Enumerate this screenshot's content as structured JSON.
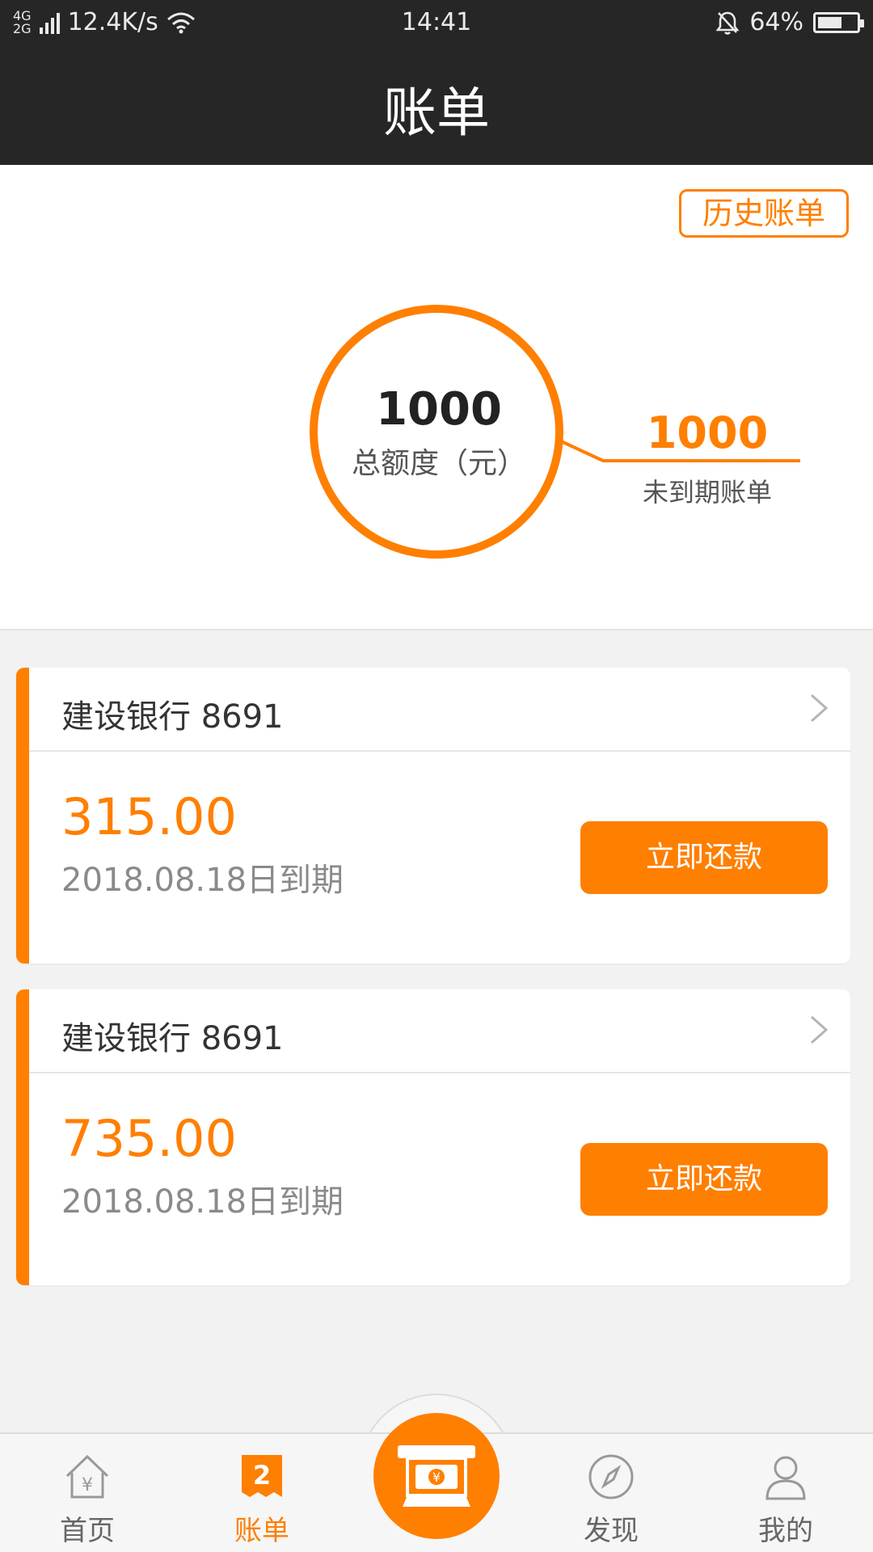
{
  "status_bar": {
    "network": "4G 2G",
    "speed": "12.4K/s",
    "time": "14:41",
    "battery": "64%",
    "battery_level": 0.64
  },
  "header": {
    "title": "账单"
  },
  "summary": {
    "history_button": "历史账单",
    "total_amount": "1000",
    "total_label": "总额度（元）",
    "unexpired_amount": "1000",
    "unexpired_label": "未到期账单"
  },
  "bills": [
    {
      "bank": "建设银行 8691",
      "amount": "315.00",
      "due": "2018.08.18日到期",
      "pay_label": "立即还款"
    },
    {
      "bank": "建设银行 8691",
      "amount": "735.00",
      "due": "2018.08.18日到期",
      "pay_label": "立即还款"
    }
  ],
  "tabbar": {
    "items": [
      {
        "label": "首页",
        "icon": "home-yen-icon"
      },
      {
        "label": "账单",
        "icon": "bill-badge-icon",
        "badge": "2",
        "active": true
      },
      {
        "label": "",
        "icon": "atm-cash-icon"
      },
      {
        "label": "发现",
        "icon": "compass-icon"
      },
      {
        "label": "我的",
        "icon": "user-icon"
      }
    ]
  },
  "colors": {
    "accent": "#ff7f00",
    "header_bg": "#262626",
    "page_bg": "#f2f2f2"
  }
}
